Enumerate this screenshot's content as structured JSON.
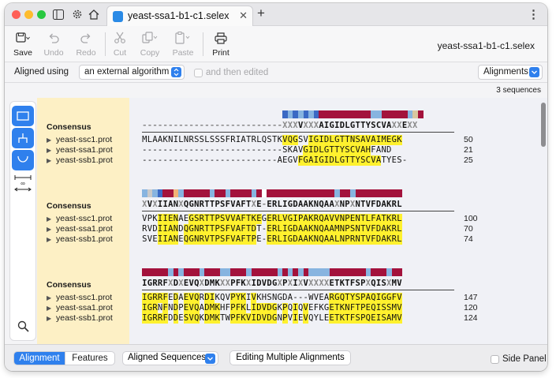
{
  "window": {
    "tab_title": "yeast-ssa1-b1-c1.selex",
    "doc_title": "yeast-ssa1-b1-c1.selex",
    "icons": [
      "sidebar-icon",
      "gear-icon",
      "home-icon",
      "close-icon",
      "plus-icon",
      "more-icon"
    ],
    "traffic_lights": [
      "#fe5f57",
      "#febc2e",
      "#28c840"
    ]
  },
  "toolbar": {
    "save_label": "Save",
    "undo_label": "Undo",
    "redo_label": "Redo",
    "cut_label": "Cut",
    "copy_label": "Copy",
    "paste_label": "Paste",
    "print_label": "Print"
  },
  "options": {
    "aligned_using_label": "Aligned using",
    "algorithm_value": "an external algorithm",
    "then_edited_label": "and then edited",
    "view_value": "Alignments",
    "sequence_count": "3 sequences"
  },
  "colors": {
    "accent": "#2f80ed",
    "highlight": "#fff12e",
    "names_bg": "#fdf0c5"
  },
  "blocks": [
    {
      "consensus_label": "Consensus",
      "consensus": "---------------------------XXXVXXXAIGIDLGTTYSCVAXXEXX",
      "consensus_colors": [
        "#3b69c4",
        "#87b4e0",
        "#3b69c4",
        "#87b4e0",
        "#3b69c4",
        "#87b4e0",
        "#3b69c4",
        "#a3123c",
        "#a3123c",
        "#a3123c",
        "#a3123c",
        "#a3123c",
        "#a3123c",
        "#a3123c",
        "#a3123c",
        "#a3123c",
        "#a3123c",
        "#87b4e0",
        "#87b4e0",
        "#a3123c",
        "#a3123c",
        "#a3123c",
        "#a3123c",
        "#a3123c",
        "#87b4e0",
        "#d9c7a0",
        "#a3123c"
      ],
      "consensus_bar_start": 27,
      "rows": [
        {
          "name": "yeast-ssc1.prot",
          "seq": "MLAAKNILNRSSLSSSFRIATRLQSTKVQGSVIGIDLGTTNSAVAIMEGK",
          "end": "50",
          "hl": [
            27,
            28,
            29,
            32,
            33,
            34,
            35,
            36,
            37,
            38,
            39,
            40,
            41,
            42,
            43,
            44,
            45,
            46,
            47,
            48,
            49
          ]
        },
        {
          "name": "yeast-ssa1.prot",
          "seq": "---------------------------SKAVGIDLGTTYSCVAHFAND",
          "end": "21",
          "hl": [
            31,
            32,
            33,
            34,
            35,
            36,
            37,
            38,
            39,
            40,
            41,
            42,
            43
          ]
        },
        {
          "name": "yeast-ssb1.prot",
          "seq": "--------------------------AEGVFGAIGIDLGTTYSCVATYES-",
          "end": "25",
          "hl": [
            30,
            31,
            32,
            33,
            34,
            35,
            36,
            37,
            38,
            39,
            40,
            41,
            42,
            43,
            44,
            45
          ]
        }
      ]
    },
    {
      "consensus_label": "Consensus",
      "consensus": "XVXIIANXQGNRTTPSFVAFTXE-ERLIGDAAKNQAAXNPXNTVFDAKRL",
      "consensus_colors": [
        "#87b4e0",
        "#c9c9c9",
        "#87b4e0",
        "#3b69c4",
        "#a3123c",
        "#a3123c",
        "#f2b277",
        "#87b4e0",
        "#a3123c",
        "#a3123c",
        "#a3123c",
        "#a3123c",
        "#a3123c",
        "#87b4e0",
        "#a3123c",
        "#a3123c",
        "#87b4e0",
        "#a3123c",
        "#a3123c",
        "#a3123c",
        "#a3123c",
        "#87b4e0",
        "#a3123c",
        "#ffffff",
        "#a3123c",
        "#a3123c",
        "#a3123c",
        "#a3123c",
        "#a3123c",
        "#a3123c",
        "#a3123c",
        "#a3123c",
        "#a3123c",
        "#a3123c",
        "#a3123c",
        "#a3123c",
        "#a3123c",
        "#87b4e0",
        "#a3123c",
        "#a3123c",
        "#87b4e0",
        "#a3123c",
        "#a3123c",
        "#a3123c",
        "#a3123c",
        "#a3123c",
        "#a3123c",
        "#a3123c",
        "#a3123c",
        "#a3123c"
      ],
      "consensus_bar_start": 0,
      "rows": [
        {
          "name": "yeast-ssc1.prot",
          "seq": "VPKIIENAEGSRTTPSVVAFTKEGERLVGIPAKRQAVVNPENTLFATKRL",
          "end": "100",
          "hl": [
            3,
            4,
            5,
            6,
            9,
            10,
            11,
            12,
            13,
            14,
            15,
            16,
            17,
            18,
            19,
            20,
            21,
            22,
            24,
            25,
            26,
            27,
            28,
            29,
            30,
            31,
            32,
            33,
            34,
            35,
            36,
            37,
            38,
            39,
            40,
            41,
            42,
            43,
            44,
            45,
            46,
            47,
            48,
            49
          ]
        },
        {
          "name": "yeast-ssa1.prot",
          "seq": "RVDIIANDQGNRTTPSFVAFTDT-ERLIGDAAKNQAAMNPSNTVFDAKRL",
          "end": "70",
          "hl": [
            3,
            4,
            5,
            6,
            8,
            9,
            10,
            11,
            12,
            13,
            14,
            15,
            16,
            17,
            18,
            19,
            20,
            21,
            24,
            25,
            26,
            27,
            28,
            29,
            30,
            31,
            32,
            33,
            34,
            35,
            36,
            37,
            38,
            39,
            40,
            41,
            42,
            43,
            44,
            45,
            46,
            47,
            48,
            49
          ]
        },
        {
          "name": "yeast-ssb1.prot",
          "seq": "SVEIIANEQGNRVTPSFVAFTPE-ERLIGDAAKNQAALNPRNTVFDAKRL",
          "end": "74",
          "hl": [
            3,
            4,
            5,
            6,
            8,
            9,
            10,
            11,
            12,
            13,
            14,
            15,
            16,
            17,
            18,
            19,
            20,
            21,
            24,
            25,
            26,
            27,
            28,
            29,
            30,
            31,
            32,
            33,
            34,
            35,
            36,
            37,
            38,
            39,
            40,
            41,
            42,
            43,
            44,
            45,
            46,
            47,
            48,
            49
          ]
        }
      ]
    },
    {
      "consensus_label": "Consensus",
      "consensus": "IGRRFXDXEVQXDMKXXPFKXIDVDGXPXIXVXXXXETKTFSPXQISXMV",
      "consensus_colors": [
        "#a3123c",
        "#a3123c",
        "#a3123c",
        "#a3123c",
        "#a3123c",
        "#87b4e0",
        "#a3123c",
        "#87b4e0",
        "#a3123c",
        "#a3123c",
        "#a3123c",
        "#87b4e0",
        "#a3123c",
        "#a3123c",
        "#a3123c",
        "#87b4e0",
        "#87b4e0",
        "#a3123c",
        "#a3123c",
        "#a3123c",
        "#87b4e0",
        "#a3123c",
        "#a3123c",
        "#a3123c",
        "#a3123c",
        "#a3123c",
        "#87b4e0",
        "#a3123c",
        "#87b4e0",
        "#a3123c",
        "#87b4e0",
        "#a3123c",
        "#87b4e0",
        "#87b4e0",
        "#87b4e0",
        "#87b4e0",
        "#a3123c",
        "#a3123c",
        "#a3123c",
        "#a3123c",
        "#a3123c",
        "#a3123c",
        "#a3123c",
        "#87b4e0",
        "#a3123c",
        "#a3123c",
        "#a3123c",
        "#87b4e0",
        "#a3123c",
        "#a3123c"
      ],
      "consensus_bar_start": 0,
      "rows": [
        {
          "name": "yeast-ssc1.prot",
          "seq": "IGRRFEDAEVQRDIKQVPYKIVKHSNGDA---WVEARGQTYSPAQIGGFV",
          "end": "147",
          "hl": [
            0,
            1,
            2,
            3,
            4,
            6,
            8,
            9,
            10,
            12,
            13,
            17,
            18,
            19,
            21,
            36,
            37,
            38,
            39,
            40,
            41,
            42,
            43,
            44,
            45,
            46,
            47,
            48,
            49
          ]
        },
        {
          "name": "yeast-ssa1.prot",
          "seq": "IGRNFNDPEVQADMKHFPFKLIDVDGKPQIQVEFKGETKNFTPEQISSMV",
          "end": "120",
          "hl": [
            0,
            1,
            2,
            4,
            6,
            8,
            9,
            10,
            12,
            13,
            14,
            17,
            18,
            19,
            21,
            22,
            23,
            24,
            25,
            27,
            29,
            31,
            36,
            37,
            38,
            39,
            40,
            41,
            42,
            43,
            44,
            45,
            46,
            47,
            48,
            49
          ]
        },
        {
          "name": "yeast-ssb1.prot",
          "seq": "IGRRFDDESVQKDMKTWPFKVIDVDGNPVIEVQYLEETKTFSPQEISAMV",
          "end": "124",
          "hl": [
            0,
            1,
            2,
            3,
            4,
            6,
            8,
            9,
            10,
            12,
            13,
            14,
            17,
            18,
            19,
            20,
            21,
            22,
            23,
            24,
            25,
            27,
            29,
            31,
            36,
            37,
            38,
            39,
            40,
            41,
            42,
            43,
            44,
            45,
            46,
            47,
            48,
            49
          ]
        }
      ]
    }
  ],
  "bottom": {
    "tab_alignment": "Alignment",
    "tab_features": "Features",
    "view_select": "Aligned Sequences",
    "edit_button": "Editing Multiple Alignments",
    "side_panel_label": "Side Panel"
  }
}
